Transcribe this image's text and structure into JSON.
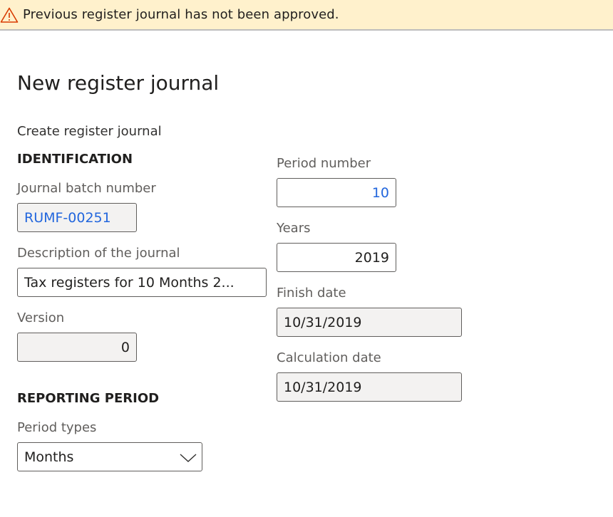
{
  "banner": {
    "icon": "warning-icon",
    "message": "Previous register journal has not been approved.",
    "background": "#fff1cc",
    "icon_color": "#d83b01"
  },
  "page": {
    "title": "New register journal",
    "subtitle": "Create register journal"
  },
  "identification": {
    "header": "IDENTIFICATION",
    "journal_batch_number": {
      "label": "Journal batch number",
      "value": "RUMF-00251"
    },
    "description": {
      "label": "Description of the journal",
      "value": "Tax registers for 10 Months 2..."
    },
    "version": {
      "label": "Version",
      "value": "0"
    }
  },
  "reporting_period": {
    "header": "REPORTING PERIOD",
    "period_types": {
      "label": "Period types",
      "value": "Months",
      "icon": "chevron-down-icon"
    }
  },
  "period": {
    "period_number": {
      "label": "Period number",
      "value": "10"
    },
    "years": {
      "label": "Years",
      "value": "2019"
    },
    "finish_date": {
      "label": "Finish date",
      "value": "10/31/2019"
    },
    "calculation_date": {
      "label": "Calculation date",
      "value": "10/31/2019"
    }
  },
  "colors": {
    "link": "#2266dd",
    "readonly_bg": "#f3f2f1",
    "label": "#605e5c"
  }
}
